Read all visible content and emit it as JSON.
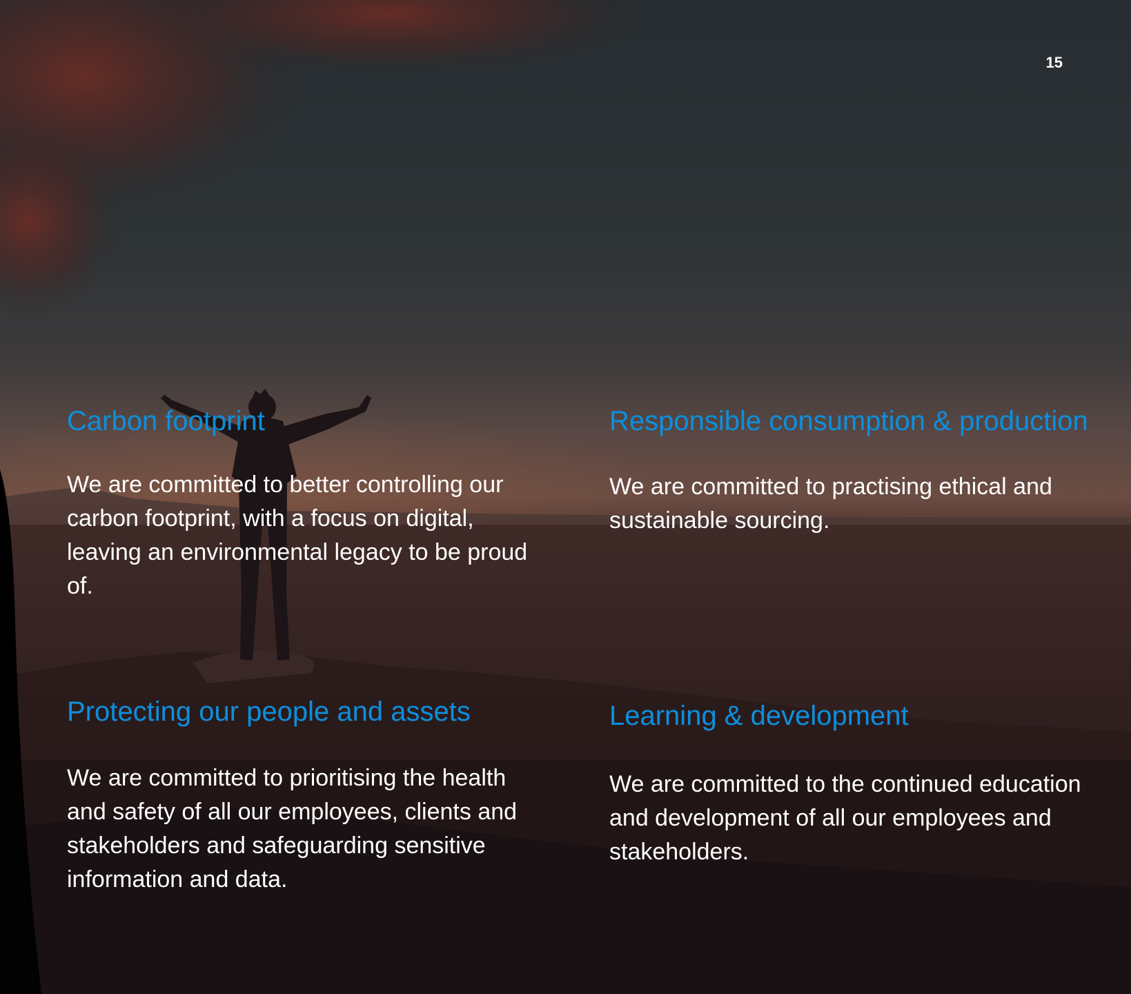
{
  "page": {
    "number": "15"
  },
  "blocks": [
    {
      "heading": "Carbon footprint",
      "body": "We are committed to better controlling our carbon footprint, with a focus on digital, leaving an environmental legacy to be proud of."
    },
    {
      "heading": "Responsible consumption & production",
      "body": "We are committed to practising ethical and sustainable sourcing."
    },
    {
      "heading": "Protecting our people and assets",
      "body": "We are committed to prioritising the health and safety of all our employees, clients and stakeholders and safeguarding sensitive information and data."
    },
    {
      "heading": "Learning & development",
      "body": "We are committed to the continued education and development of all our employees and stakeholders."
    }
  ],
  "colors": {
    "heading": "#0d8fde",
    "body_text": "#ffffff",
    "sky_top": "#2b3236",
    "sky_horizon": "#6a4a40",
    "ground": "#1a1214"
  }
}
